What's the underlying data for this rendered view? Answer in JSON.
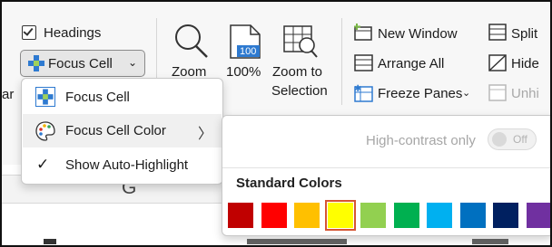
{
  "ribbon": {
    "headings_label": "Headings",
    "focus_cell_button": "Focus Cell",
    "zoom_label": "Zoom",
    "zoom100_label": "100%",
    "zoom100_icon_text": "100",
    "zoom_selection_line1": "Zoom to",
    "zoom_selection_line2": "Selection",
    "new_window_label": "New Window",
    "arrange_all_label": "Arrange All",
    "freeze_panes_label": "Freeze Panes",
    "split_label": "Split",
    "hide_label": "Hide",
    "unhide_label": "Unhi",
    "left_cut_text": "ar"
  },
  "menu": {
    "items": [
      {
        "label": "Focus Cell",
        "icon": "focus-cell-icon"
      },
      {
        "label": "Focus Cell Color",
        "icon": "palette-icon"
      },
      {
        "label": "Show Auto-Highlight",
        "icon": "check-icon"
      }
    ]
  },
  "submenu": {
    "high_contrast_label": "High-contrast only",
    "toggle_state": "Off",
    "section_title": "Standard Colors",
    "colors": [
      "#c00000",
      "#ff0000",
      "#ffc000",
      "#ffff00",
      "#92d050",
      "#00b050",
      "#00b0f0",
      "#0070c0",
      "#002060",
      "#7030a0"
    ],
    "selected_color": "#ffff00"
  },
  "sheet": {
    "column_letter": "G"
  }
}
